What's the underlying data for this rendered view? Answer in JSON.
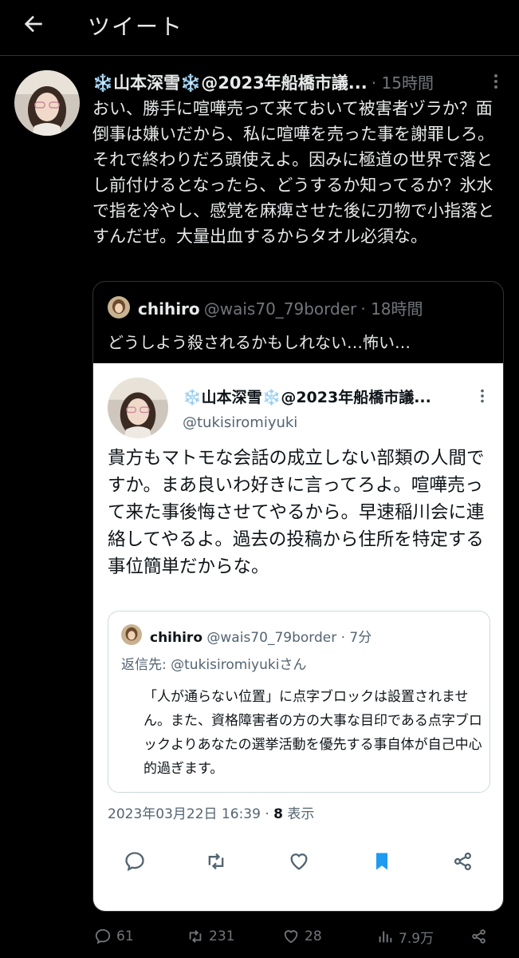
{
  "header": {
    "title": "ツイート"
  },
  "tweet": {
    "name": "❄️山本深雪❄️@2023年船橋市議...",
    "time": "· 15時間",
    "text": "おい、勝手に喧嘩売って来ておいて被害者ヅラか？面倒事は嫌いだから、私に喧嘩を売った事を謝罪しろ。それで終わりだろ頭使えよ。因みに極道の世界で落とし前付けるとなったら、どうするか知ってるか？氷水で指を冷やし、感覚を麻痺させた後に刃物で小指落とすんだぜ。大量出血するからタオル必須な。"
  },
  "quoted": {
    "name": "chihiro",
    "handle": "@wais70_79border",
    "time": "· 18時間",
    "text": "どうしよう殺されるかもしれない…怖い…"
  },
  "screenshot": {
    "name": "❄️山本深雪❄️@2023年船橋市議...",
    "handle": "@tukisiromiyuki",
    "text": "貴方もマトモな会話の成立しない部類の人間ですか。まあ良いわ好きに言ってろよ。喧嘩売って来た事後悔させてやるから。早速稲川会に連絡してやるよ。過去の投稿から住所を特定する事位簡単だからな。",
    "quote": {
      "name": "chihiro",
      "handle": "@wais70_79border",
      "time": "· 7分",
      "reply_to": "返信先: @tukisiromiyukiさん",
      "text": "「人が通らない位置」に点字ブロックは設置されません。また、資格障害者の方の大事な目印である点字ブロックよりあなたの選挙活動を優先する事自体が自己中心的過ぎます。"
    },
    "footer_date": "2023年03月22日 16:39 · ",
    "footer_views": "8",
    "footer_views_label": " 表示"
  },
  "actions": {
    "replies": "61",
    "retweets": "231",
    "likes": "28",
    "views": "7.9万"
  },
  "colors": {
    "accent_blue": "#1d9bf0",
    "snow_blue": "#8ecdf7"
  }
}
